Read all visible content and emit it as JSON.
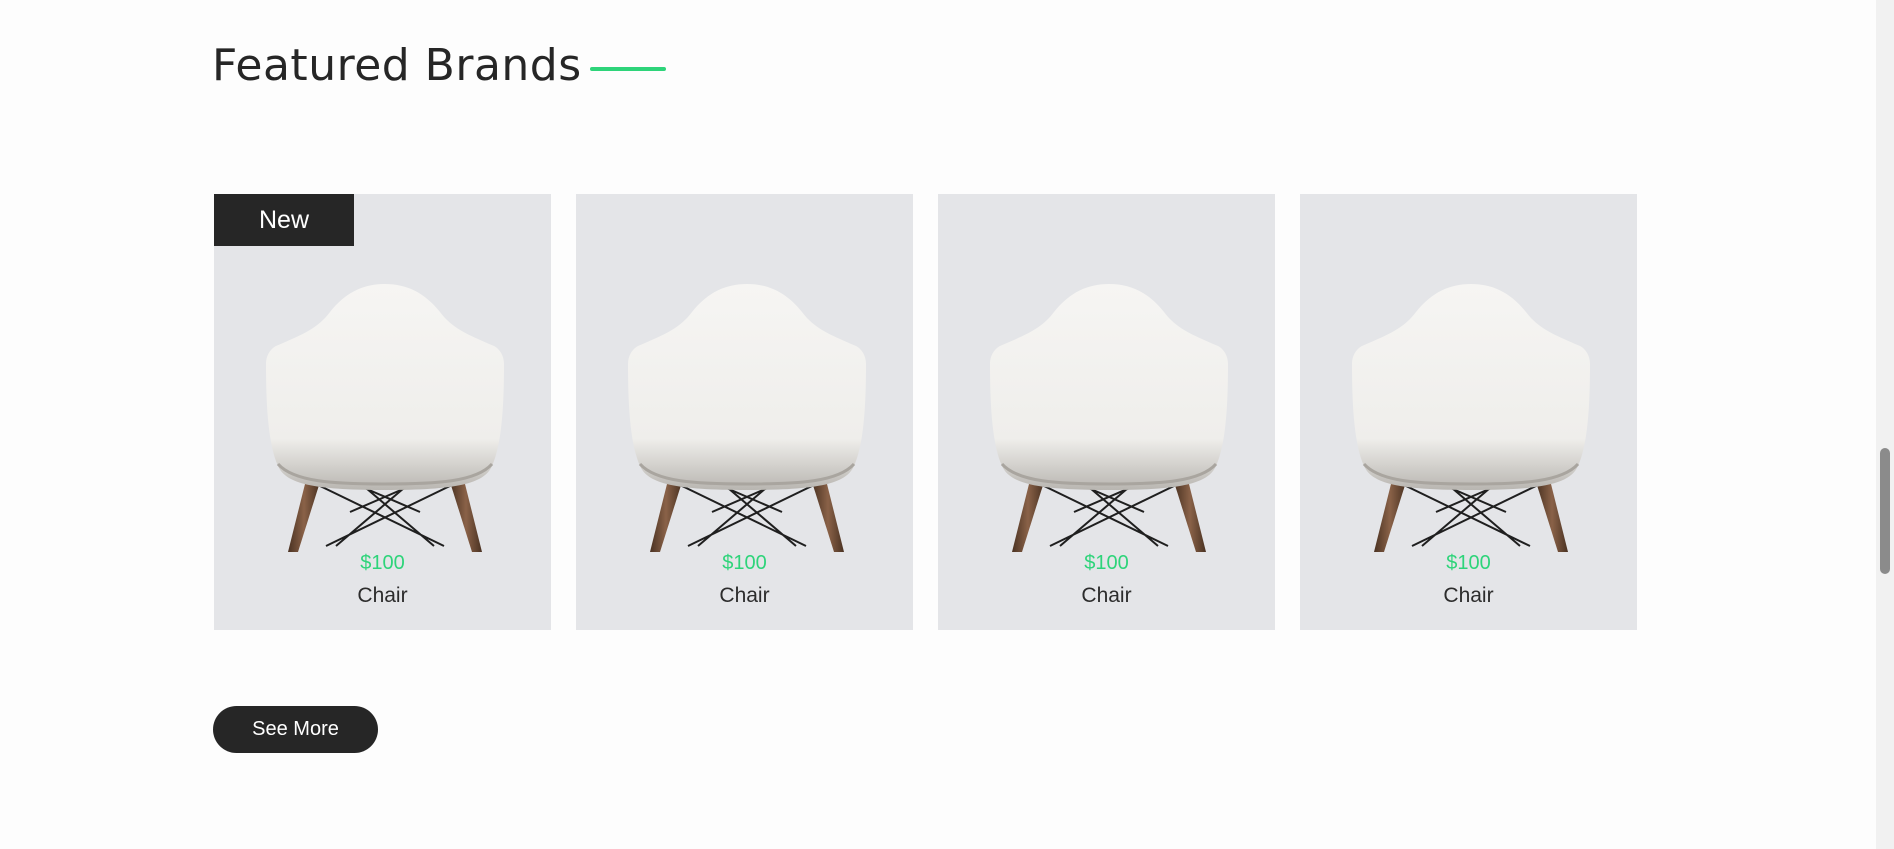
{
  "section": {
    "title": "Featured Brands",
    "accent_color": "#2ed47a"
  },
  "products": [
    {
      "badge": "New",
      "price": "$100",
      "name": "Chair",
      "image_icon": "chair-image"
    },
    {
      "badge": "",
      "price": "$100",
      "name": "Chair",
      "image_icon": "chair-image"
    },
    {
      "badge": "",
      "price": "$100",
      "name": "Chair",
      "image_icon": "chair-image"
    },
    {
      "badge": "",
      "price": "$100",
      "name": "Chair",
      "image_icon": "chair-image"
    }
  ],
  "actions": {
    "see_more_label": "See More"
  }
}
